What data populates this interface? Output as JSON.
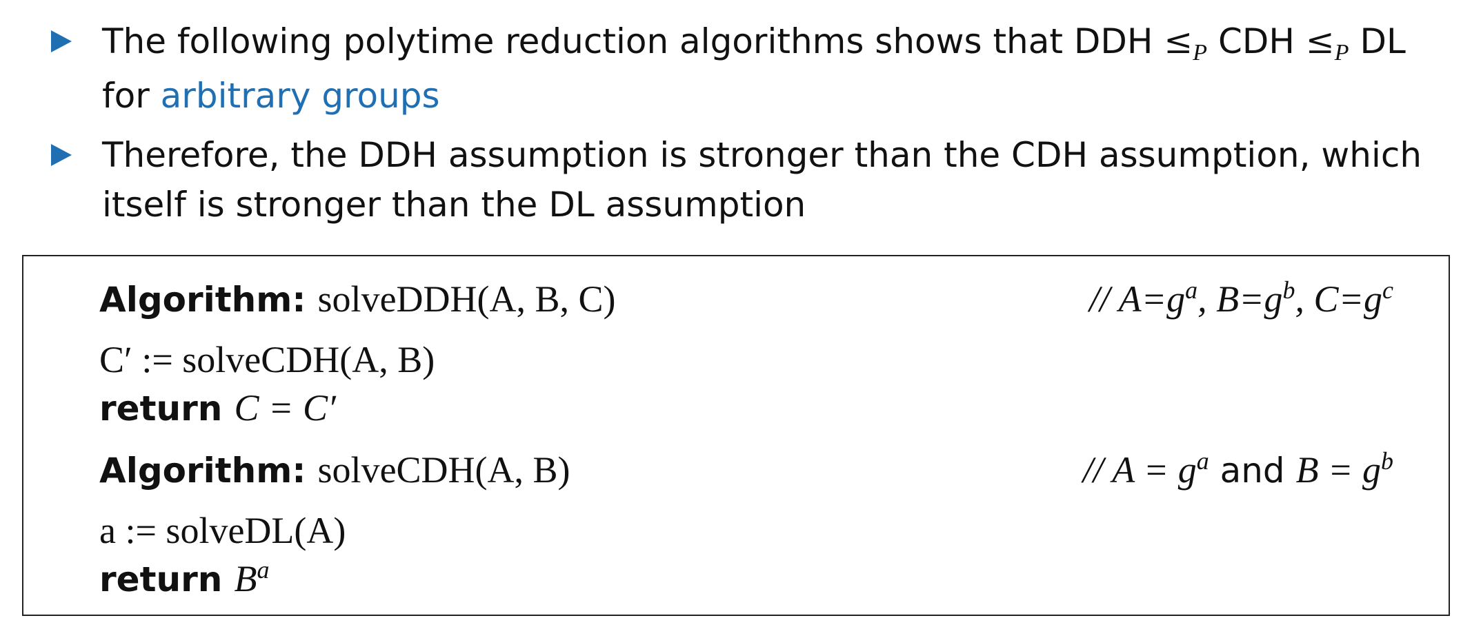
{
  "bullets": [
    {
      "text_before": "The following polytime reduction algorithms shows that DDH ",
      "le_symbol": "≤",
      "le_sub": "P",
      "text_middle": " CDH ",
      "text_after": " DL",
      "line2_prefix": "for ",
      "link_text": "arbitrary groups"
    },
    {
      "line1": "Therefore, the DDH assumption is stronger than the CDH assumption, which",
      "line2": "itself is stronger than the DL assumption"
    }
  ],
  "algo1": {
    "keyword": "Algorithm:",
    "signature": "solveDDH(A, B, C)",
    "comment": "// A=g",
    "comment_a": "a",
    "comment_b_text": ", B=g",
    "comment_b": "b",
    "comment_c_text": ", C=g",
    "comment_c": "c",
    "step1": "C′ := solveCDH(A, B)",
    "return_kw": "return",
    "return_expr": "C = C′"
  },
  "algo2": {
    "keyword": "Algorithm:",
    "signature": "solveCDH(A, B)",
    "comment": "// A = g",
    "comment_a": "a",
    "comment_and": " and ",
    "comment_b_text": "B = g",
    "comment_b": "b",
    "step1": "a := solveDL(A)",
    "return_kw": "return",
    "return_base": "B",
    "return_exp": "a"
  },
  "colors": {
    "accent": "#1f6fb2",
    "text": "#111111",
    "border": "#222222"
  }
}
